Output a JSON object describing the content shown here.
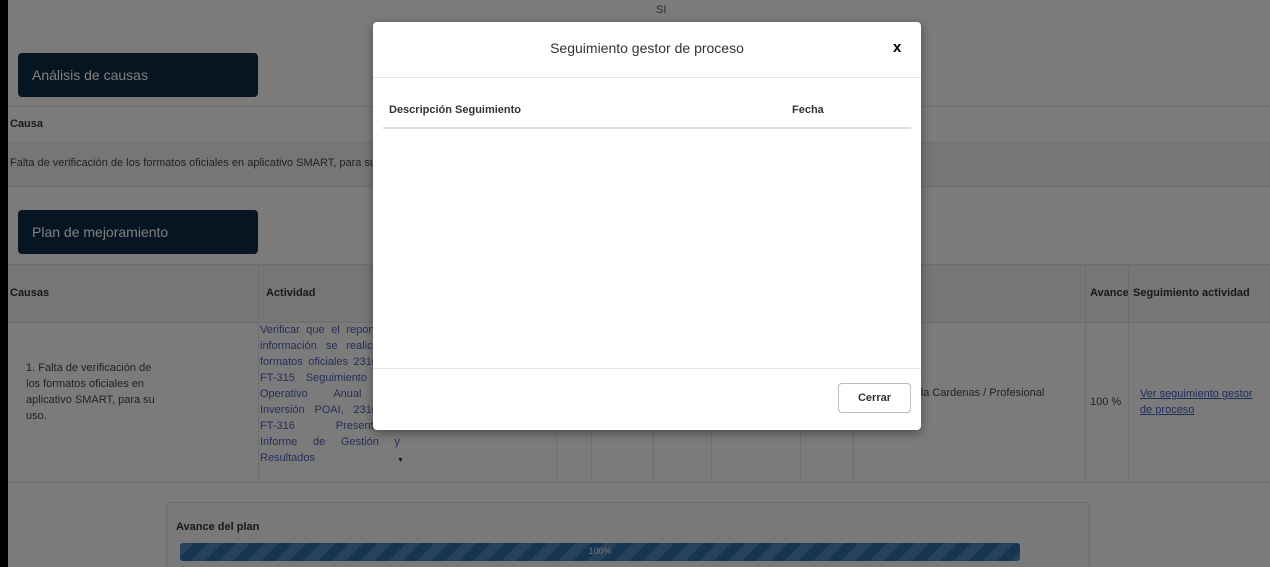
{
  "top_value": "SI",
  "sections": {
    "analisis_title": "Análisis de causas",
    "plan_title": "Plan de mejoramiento"
  },
  "causa_table": {
    "header": "Causa",
    "value": "Falta de verificación de los formatos oficiales en aplicativo SMART, para su uso."
  },
  "plan_table": {
    "headers": {
      "causas": "Causas",
      "actividad": "Actividad",
      "avance": "Avance",
      "seguimiento": "Seguimiento actividad"
    },
    "row": {
      "causa": "1. Falta de verificación de los formatos oficiales en aplicativo SMART, para su uso.",
      "actividad": "Verificar que el reporte de información se realice en formatos oficiales 2310100-FT-315 Seguimiento Plan Operativo Anual de Inversión POAI, 2310100-FT-316 Presentación Informe de Gestión y Resultados",
      "responsable": "Ojeda Cardenas / Profesional",
      "avance": "100 %",
      "seguimiento_link": "Ver seguimiento gestor de proceso"
    }
  },
  "plan_progress": {
    "label": "Avance del plan",
    "percent": 100,
    "percent_text": "100%",
    "color": "#2a6aa6"
  },
  "modal": {
    "title": "Seguimiento gestor de proceso",
    "close_symbol": "x",
    "columns": [
      "Descripción Seguimiento",
      "Fecha"
    ],
    "rows": [],
    "close_button": "Cerrar"
  },
  "colors": {
    "section_header": "#0e2a44",
    "link": "#3b5bb5",
    "overlay": "rgba(0,0,0,0.5)"
  }
}
